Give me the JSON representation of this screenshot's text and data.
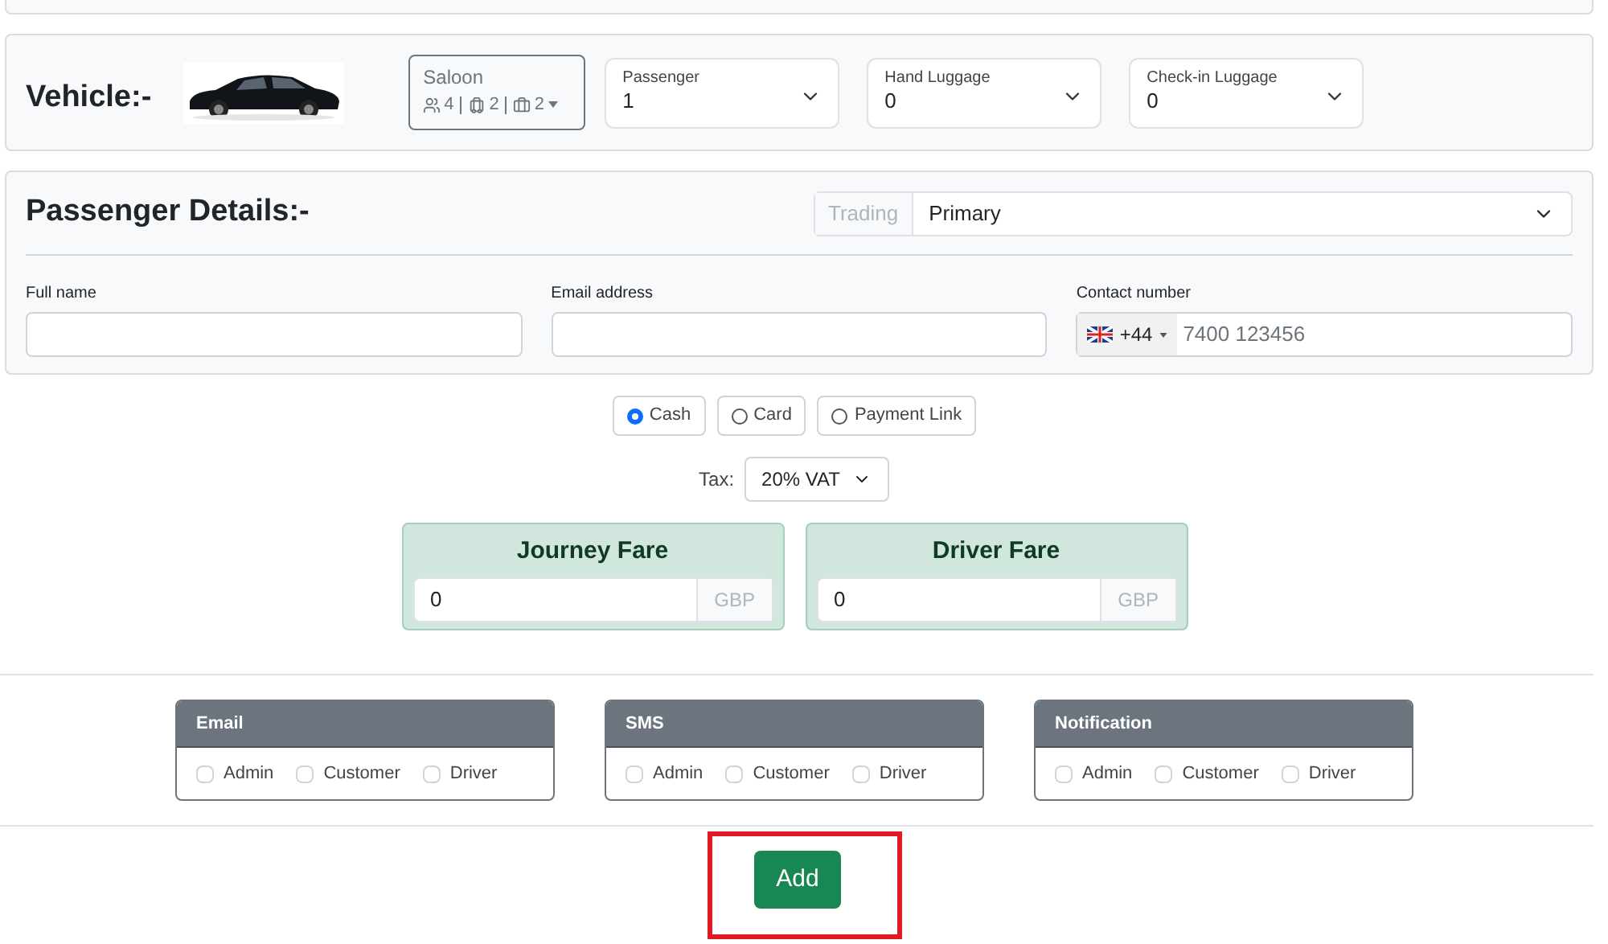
{
  "vehicle": {
    "title": "Vehicle:-",
    "type": {
      "name": "Saloon",
      "passengers": "4",
      "suitcases": "2",
      "bags": "2"
    },
    "selects": [
      {
        "label": "Passenger",
        "value": "1"
      },
      {
        "label": "Hand Luggage",
        "value": "0"
      },
      {
        "label": "Check-in Luggage",
        "value": "0"
      }
    ]
  },
  "passenger_details": {
    "title": "Passenger Details:-",
    "account": {
      "prefix": "Trading",
      "value": "Primary"
    },
    "fields": [
      {
        "label": "Full name",
        "kind": "text"
      },
      {
        "label": "Email address",
        "kind": "text"
      },
      {
        "label": "Contact number",
        "kind": "phone",
        "code": "+44",
        "placeholder": "7400 123456"
      }
    ]
  },
  "payment_methods": [
    {
      "label": "Cash",
      "selected": true
    },
    {
      "label": "Card",
      "selected": false
    },
    {
      "label": "Payment Link",
      "selected": false
    }
  ],
  "tax": {
    "label": "Tax:",
    "value": "20% VAT"
  },
  "fares": [
    {
      "title": "Journey Fare",
      "value": "0",
      "currency": "GBP"
    },
    {
      "title": "Driver Fare",
      "value": "0",
      "currency": "GBP"
    }
  ],
  "notify_groups": [
    {
      "title": "Email",
      "options": [
        {
          "label": "Admin",
          "checked": false
        },
        {
          "label": "Customer",
          "checked": false
        },
        {
          "label": "Driver",
          "checked": false
        }
      ]
    },
    {
      "title": "SMS",
      "options": [
        {
          "label": "Admin",
          "checked": false
        },
        {
          "label": "Customer",
          "checked": false
        },
        {
          "label": "Driver",
          "checked": false
        }
      ]
    },
    {
      "title": "Notification",
      "options": [
        {
          "label": "Admin",
          "checked": false
        },
        {
          "label": "Customer",
          "checked": false
        },
        {
          "label": "Driver",
          "checked": false
        }
      ]
    }
  ],
  "add_button": {
    "label": "Add",
    "highlighted": true
  }
}
